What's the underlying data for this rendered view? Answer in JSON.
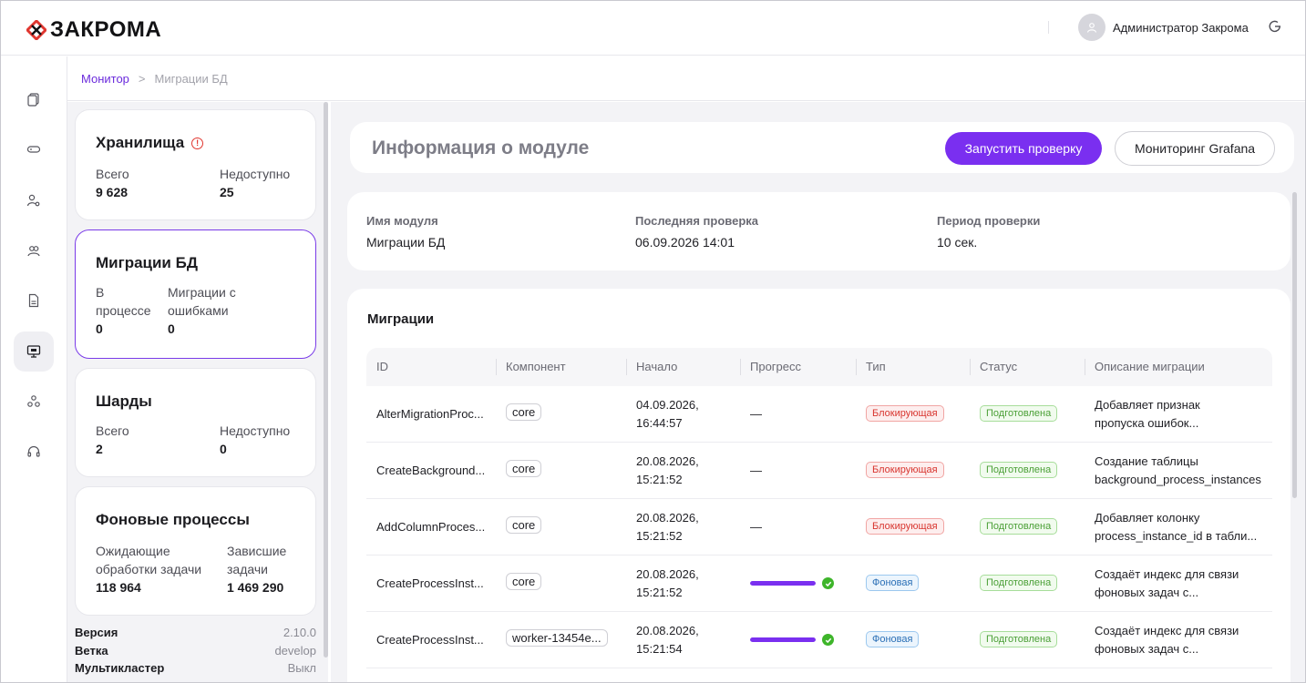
{
  "app": {
    "logo_text": "ЗАКРОМА",
    "user_name": "Администратор Закрома"
  },
  "breadcrumb": {
    "parent": "Монитор",
    "separator": ">",
    "current": "Миграции БД"
  },
  "sidebar_icons": [
    "documents-icon",
    "storage-icon",
    "user-settings-icon",
    "users-icon",
    "file-icon",
    "monitor-icon",
    "cluster-icon",
    "support-headset-icon"
  ],
  "cards": {
    "storage": {
      "title": "Хранилища",
      "total_label": "Всего",
      "total_value": "9 628",
      "unavailable_label": "Недоступно",
      "unavailable_value": "25"
    },
    "migrations": {
      "title": "Миграции БД",
      "inprogress_label": "В процессе",
      "inprogress_value": "0",
      "errors_label": "Миграции с ошибками",
      "errors_value": "0"
    },
    "shards": {
      "title": "Шарды",
      "total_label": "Всего",
      "total_value": "2",
      "unavailable_label": "Недоступно",
      "unavailable_value": "0"
    },
    "background": {
      "title": "Фоновые процессы",
      "waiting_label": "Ожидающие обработки задачи",
      "waiting_value": "118 964",
      "hung_label": "Зависшие задачи",
      "hung_value": "1 469 290"
    }
  },
  "meta": {
    "version_label": "Версия",
    "version_value": "2.10.0",
    "branch_label": "Ветка",
    "branch_value": "develop",
    "multicluster_label": "Мультикластер",
    "multicluster_value": "Выкл"
  },
  "module": {
    "title": "Информация о модуле",
    "run_check_button": "Запустить проверку",
    "grafana_button": "Мониторинг Grafana",
    "name_label": "Имя модуля",
    "name_value": "Миграции БД",
    "last_check_label": "Последняя проверка",
    "last_check_value": "06.09.2026 14:01",
    "period_label": "Период проверки",
    "period_value": "10 сек."
  },
  "migrations_table": {
    "title": "Миграции",
    "columns": [
      "ID",
      "Компонент",
      "Начало",
      "Прогресс",
      "Тип",
      "Статус",
      "Описание миграции"
    ],
    "rows": [
      {
        "id": "AlterMigrationProc...",
        "component": "core",
        "start_date": "04.09.2026,",
        "start_time": "16:44:57",
        "progress_text": "—",
        "progress": null,
        "type": "Блокирующая",
        "type_color": "red",
        "status": "Подготовлена",
        "desc1": "Добавляет признак",
        "desc2": "пропуска ошибок..."
      },
      {
        "id": "CreateBackground...",
        "component": "core",
        "start_date": "20.08.2026,",
        "start_time": "15:21:52",
        "progress_text": "—",
        "progress": null,
        "type": "Блокирующая",
        "type_color": "red",
        "status": "Подготовлена",
        "desc1": "Создание таблицы",
        "desc2": "background_process_instances"
      },
      {
        "id": "AddColumnProces...",
        "component": "core",
        "start_date": "20.08.2026,",
        "start_time": "15:21:52",
        "progress_text": "—",
        "progress": null,
        "type": "Блокирующая",
        "type_color": "red",
        "status": "Подготовлена",
        "desc1": "Добавляет колонку",
        "desc2": "process_instance_id в табли..."
      },
      {
        "id": "CreateProcessInst...",
        "component": "core",
        "start_date": "20.08.2026,",
        "start_time": "15:21:52",
        "progress_text": "",
        "progress": 1.0,
        "type": "Фоновая",
        "type_color": "blue",
        "status": "Подготовлена",
        "desc1": "Создаёт индекс для связи",
        "desc2": "фоновых задач с..."
      },
      {
        "id": "CreateProcessInst...",
        "component": "worker-13454e...",
        "start_date": "20.08.2026,",
        "start_time": "15:21:54",
        "progress_text": "",
        "progress": 1.0,
        "type": "Фоновая",
        "type_color": "blue",
        "status": "Подготовлена",
        "desc1": "Создаёт индекс для связи",
        "desc2": "фоновых задач с..."
      }
    ]
  },
  "colors": {
    "accent": "#7a2ff0",
    "danger": "#e0362f",
    "success": "#3eb52a"
  }
}
